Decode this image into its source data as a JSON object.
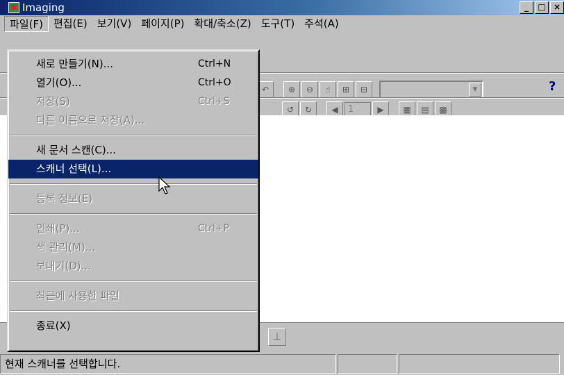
{
  "window": {
    "title": "Imaging",
    "buttons": [
      "_",
      "□",
      "×"
    ]
  },
  "menubar": [
    "파일(F)",
    "편집(E)",
    "보기(V)",
    "페이지(P)",
    "확대/축소(Z)",
    "도구(T)",
    "주석(A)"
  ],
  "file_menu": {
    "new": {
      "label": "새로 만들기(N)...",
      "shortcut": "Ctrl+N"
    },
    "open": {
      "label": "열기(O)...",
      "shortcut": "Ctrl+O"
    },
    "save": {
      "label": "저장(S)",
      "shortcut": "Ctrl+S"
    },
    "save_as": {
      "label": "다른 이름으로 저장(A)..."
    },
    "scan_new": {
      "label": "새 문서 스캔(C)..."
    },
    "select_scanner": {
      "label": "스캐너 선택(L)..."
    },
    "properties": {
      "label": "등록 정보(E)"
    },
    "print": {
      "label": "인쇄(P)...",
      "shortcut": "Ctrl+P"
    },
    "color_mgmt": {
      "label": "색 관리(M)..."
    },
    "send": {
      "label": "보내기(D)..."
    },
    "recent": {
      "label": "최근에 사용한 파일"
    },
    "exit": {
      "label": "종료(X)"
    }
  },
  "toolbar": {
    "page_number": "1",
    "help": "?"
  },
  "status": {
    "text": "현재 스캐너를 선택합니다."
  },
  "colors": {
    "title_start": "#0a246a",
    "title_end": "#a6caf0",
    "selection": "#0a246a"
  },
  "icons": [
    "app-icon",
    "zoom-in-icon",
    "zoom-out-icon",
    "select-icon",
    "fit-icon",
    "fit-width-icon",
    "rotate-left-icon",
    "rotate-right-icon",
    "prev-page-icon",
    "next-page-icon",
    "thumbnail-icon",
    "page-view-icon",
    "stamp-icon",
    "help-icon",
    "cursor-icon"
  ]
}
